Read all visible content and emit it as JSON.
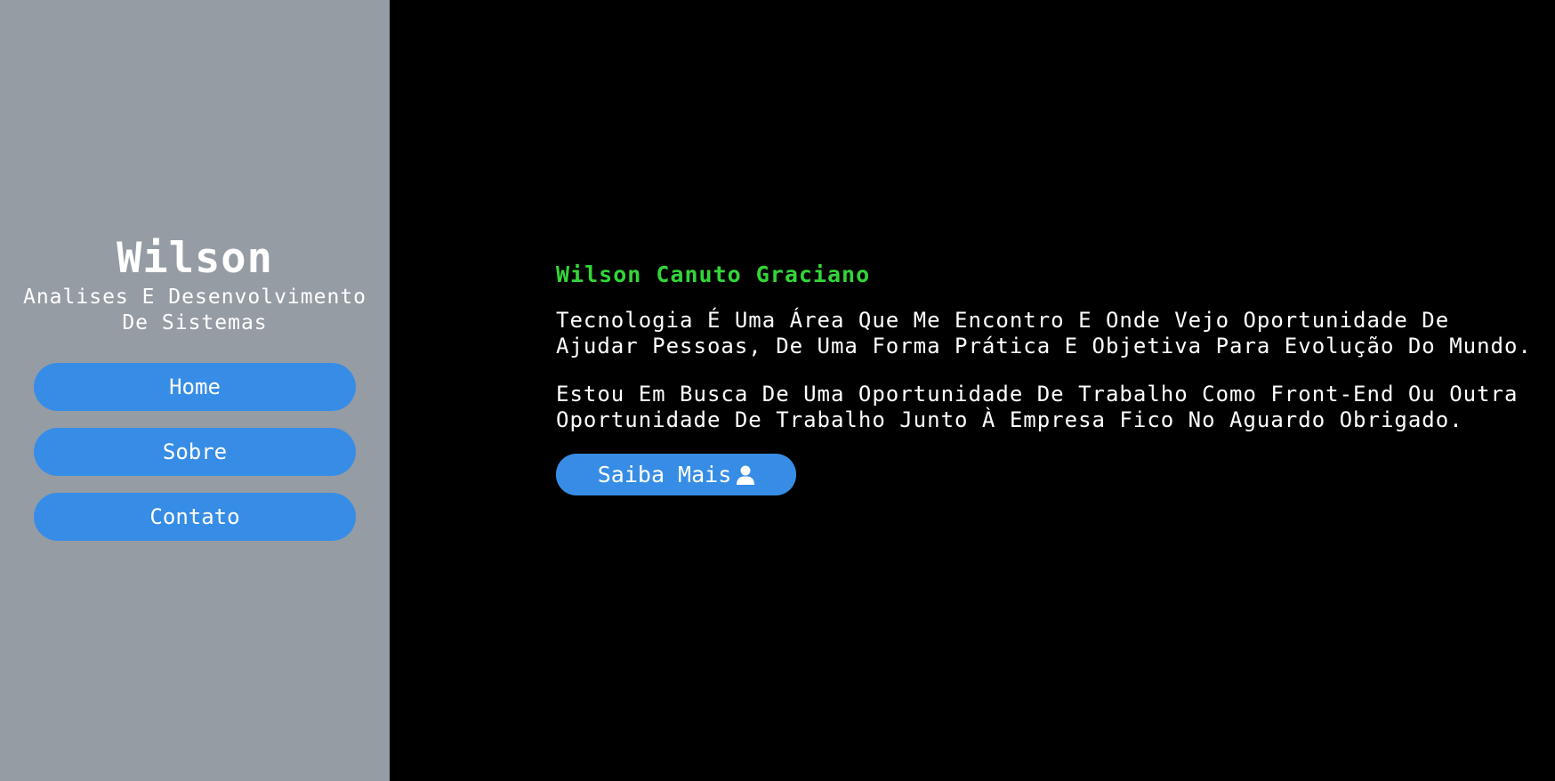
{
  "sidebar": {
    "name": "Wilson",
    "role": "Analises E Desenvolvimento De Sistemas",
    "nav": {
      "home": "Home",
      "sobre": "Sobre",
      "contato": "Contato"
    },
    "background_color": "#959ca4",
    "button_color": "#378de6"
  },
  "main": {
    "full_name": "Wilson Canuto Graciano",
    "paragraph_1": "Tecnologia É Uma Área Que Me Encontro E Onde Vejo Oportunidade De Ajudar Pessoas, De Uma Forma Prática E Objetiva Para Evolução Do Mundo.",
    "paragraph_2": "Estou Em Busca De Uma Oportunidade De Trabalho Como Front-End Ou Outra Oportunidade De Trabalho Junto À Empresa Fico No Aguardo Obrigado.",
    "cta_label": "Saiba Mais",
    "cta_icon": "user-icon",
    "name_color": "#33d637",
    "background_color": "#000000"
  }
}
